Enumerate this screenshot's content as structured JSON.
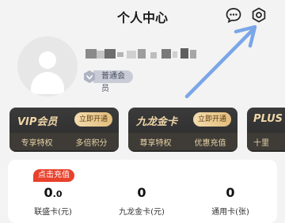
{
  "header": {
    "title": "个人中心",
    "icons": [
      "message-icon",
      "settings-gear-icon"
    ]
  },
  "profile": {
    "avatar_icon": "default-avatar-icon",
    "member_badge": "普通会员"
  },
  "cards": [
    {
      "title": "VIP会员",
      "action": "立即开通",
      "features": [
        "专享特权",
        "多倍积分"
      ]
    },
    {
      "title": "九龙金卡",
      "action": "立即开通",
      "features": [
        "尊享特权",
        "优惠充值"
      ]
    },
    {
      "title": "PLUS",
      "features": [
        "十里"
      ]
    }
  ],
  "balance": {
    "recharge_tag": "点击充值",
    "items": [
      {
        "value": "0",
        "value_suffix": ".0",
        "label": "联盛卡(元)"
      },
      {
        "value": "0",
        "value_suffix": "",
        "label": "九龙金卡(元)"
      },
      {
        "value": "0",
        "value_suffix": "",
        "label": "通用卡(张)"
      }
    ]
  },
  "colors": {
    "card_bg": "#2e2e2e",
    "gold_text": "#f0d7a8",
    "recharge_red": "#e8412c",
    "arrow_blue": "#7aa6e8"
  }
}
